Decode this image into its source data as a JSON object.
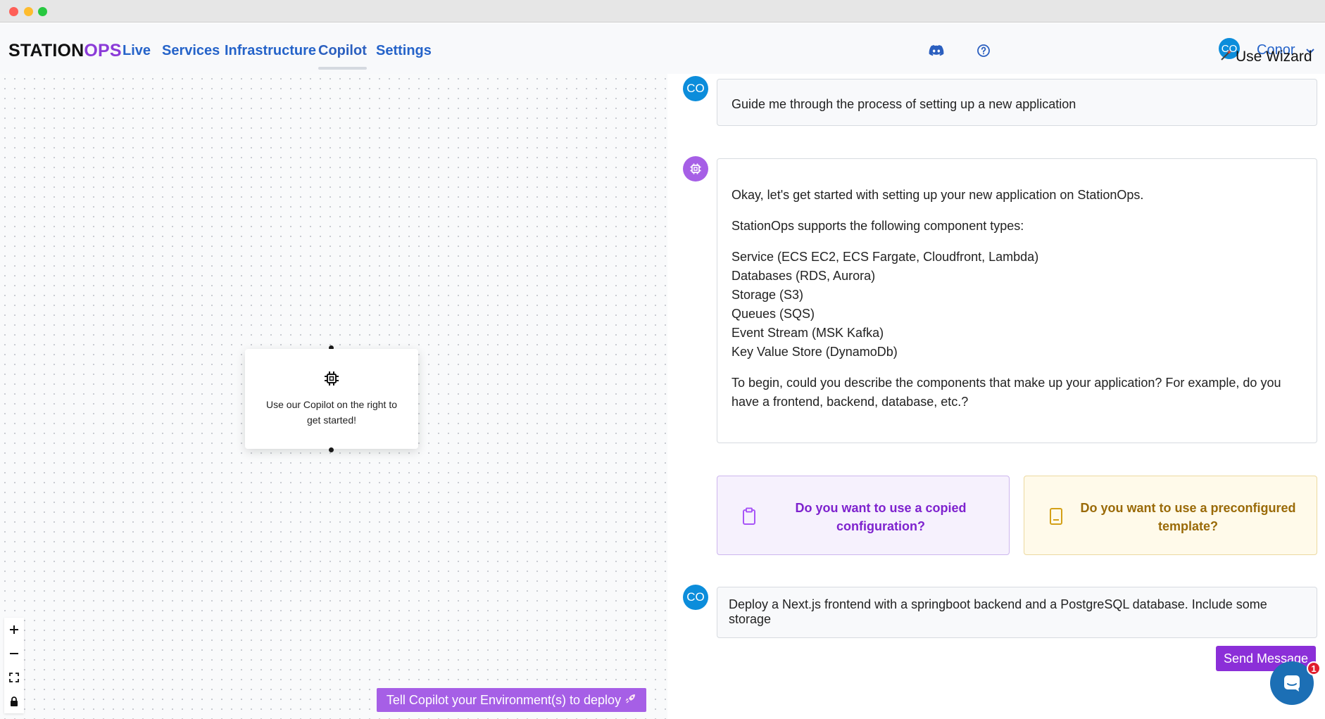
{
  "nav": {
    "brand_part1": "STATION",
    "brand_part2": "OPS",
    "links": [
      "Live",
      "Services",
      "Infrastructure",
      "Copilot",
      "Settings"
    ],
    "active": "Copilot",
    "user_initials": "CO",
    "user_name": "Conor",
    "wizard_label": "Use Wizard",
    "icons": [
      "discord-icon",
      "help-circle-icon",
      "chevron-down-icon",
      "wand-icon"
    ]
  },
  "canvas": {
    "node_text": "Use our Copilot on the right to get started!",
    "deploy_button": "Tell Copilot your Environment(s) to deploy",
    "controls": [
      "zoom-in-icon",
      "zoom-out-icon",
      "fit-view-icon",
      "lock-icon"
    ]
  },
  "chat": {
    "user_initials": "CO",
    "user_message": "Guide me through the process of setting up a new application",
    "bot_intro": "Okay, let's get started with setting up your new application on StationOps.",
    "bot_supports": "StationOps supports the following component types:",
    "component_types": [
      "Service (ECS EC2, ECS Fargate, Cloudfront, Lambda)",
      "Databases (RDS, Aurora)",
      "Storage (S3)",
      "Queues (SQS)",
      "Event Stream (MSK Kafka)",
      "Key Value Store (DynamoDb)"
    ],
    "bot_question": "To begin, could you describe the components that make up your application? For example, do you have a frontend, backend, database, etc.?",
    "option_copied": "Do you want to use a copied configuration?",
    "option_template": "Do you want to use a preconfigured template?",
    "input_value": "Deploy a Next.js frontend with a springboot backend and a PostgreSQL database. Include some storage",
    "send_label": "Send Message",
    "notification_count": "1"
  },
  "colors": {
    "accent_purple": "#8b2fd8",
    "brand_purple": "#8b3bd8",
    "link_blue": "#2563c9",
    "avatar_blue": "#0c8ddb"
  }
}
